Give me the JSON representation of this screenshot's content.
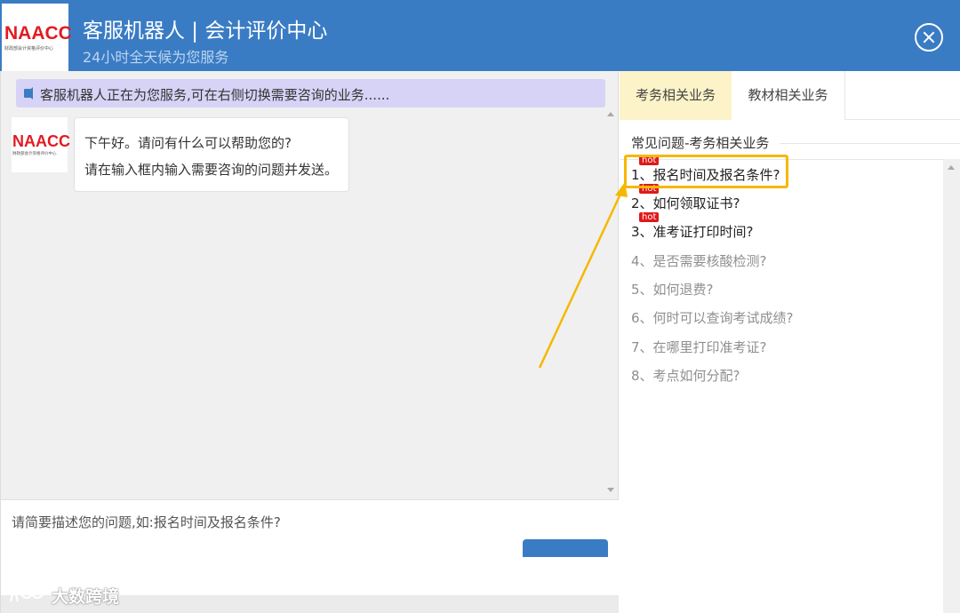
{
  "header": {
    "logo_text": "NAACC",
    "logo_subtext": "财政部会计资格评价中心",
    "title": "客服机器人 | 会计评价中心",
    "subtitle": "24小时全天候为您服务",
    "close_icon": "close-circle-icon"
  },
  "notice": {
    "icon": "speaker-icon",
    "text": "客服机器人正在为您服务,可在右侧切换需要咨询的业务......"
  },
  "chat": {
    "bot_avatar_text": "NAACC",
    "bot_avatar_subtext": "财政部会计资格评价中心",
    "messages": [
      {
        "line1": "下午好。请问有什么可以帮助您的?",
        "line2": "请在输入框内输入需要咨询的问题并发送。"
      }
    ]
  },
  "input": {
    "placeholder": "请简要描述您的问题,如:报名时间及报名条件?",
    "value": ""
  },
  "watermark": {
    "text": "大数跨境"
  },
  "tabs": [
    {
      "label": "考务相关业务",
      "active": true
    },
    {
      "label": "教材相关业务",
      "active": false
    }
  ],
  "faq": {
    "heading": "常见问题-考务相关业务",
    "hot_badge": "hot",
    "items": [
      {
        "label": "1、报名时间及报名条件?",
        "hot": true
      },
      {
        "label": "2、如何领取证书?",
        "hot": true
      },
      {
        "label": "3、准考证打印时间?",
        "hot": true
      },
      {
        "label": "4、是否需要核酸检测?",
        "hot": false
      },
      {
        "label": "5、如何退费?",
        "hot": false
      },
      {
        "label": "6、何时可以查询考试成绩?",
        "hot": false
      },
      {
        "label": "7、在哪里打印准考证?",
        "hot": false
      },
      {
        "label": "8、考点如何分配?",
        "hot": false
      }
    ]
  },
  "colors": {
    "header_bg": "#3a7cc4",
    "notice_bg": "#d7d3f7",
    "active_tab_bg": "#fcf3c8",
    "hot_badge": "#e01818",
    "highlight": "#f5b800"
  }
}
